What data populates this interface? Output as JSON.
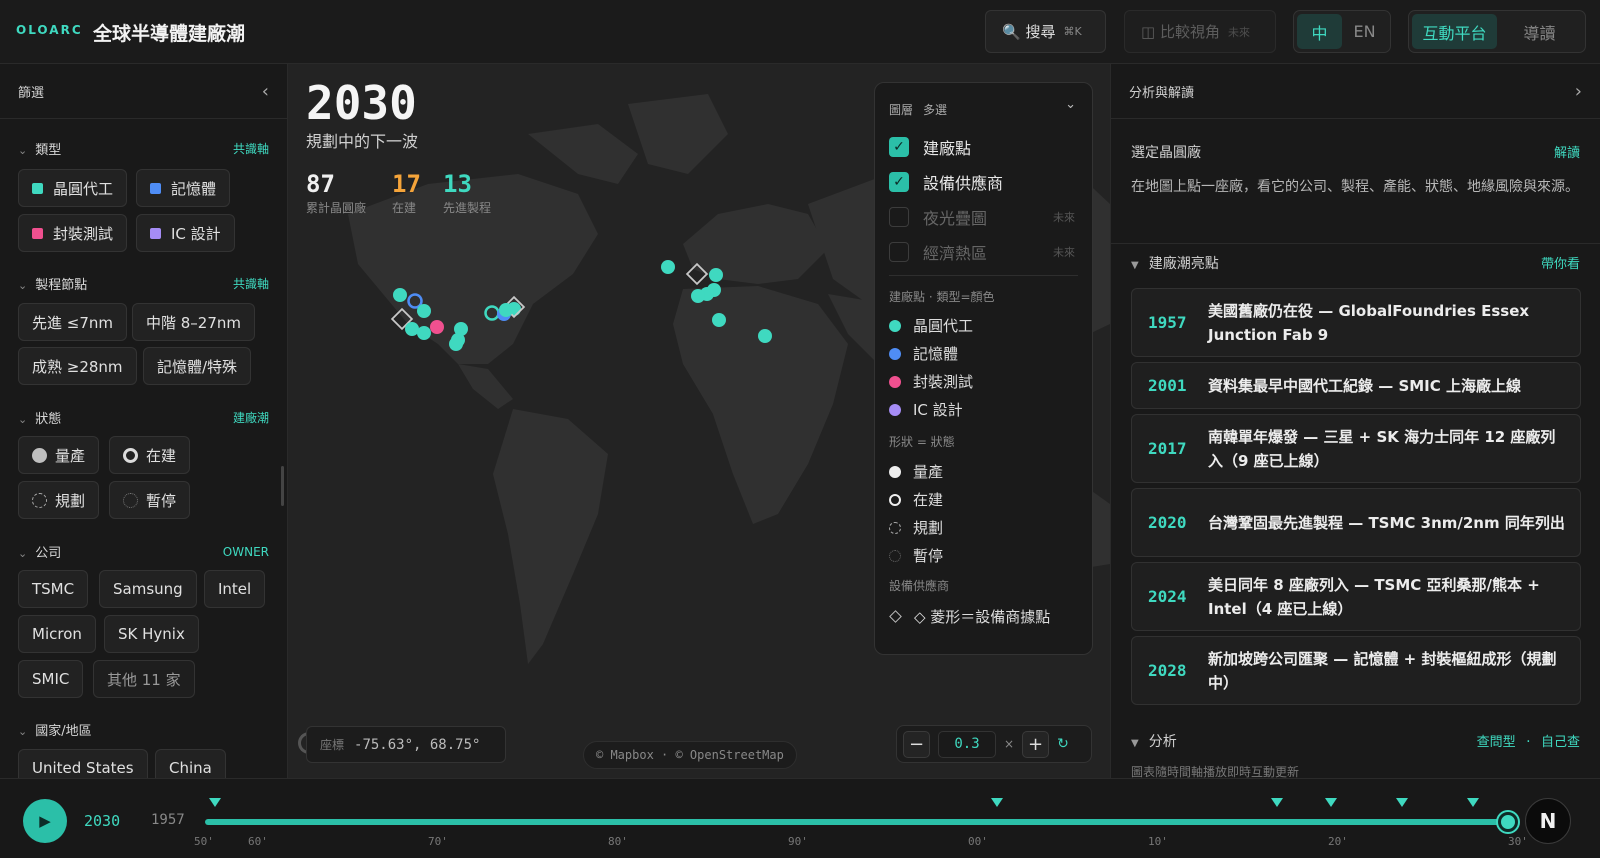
{
  "header": {
    "brand": "OLOARC",
    "title": "全球半導體建廠潮",
    "search_label": "🔍 搜尋",
    "search_kbd": "⌘K",
    "compare_label": "◫ 比較視角",
    "compare_soon": "未來",
    "lang_zh": "中",
    "lang_en": "EN",
    "mode_interactive": "互動平台",
    "mode_guide": "導讀"
  },
  "left": {
    "title": "篩選",
    "collapse_icon": "‹",
    "type": {
      "label": "類型",
      "tag": "共識軸",
      "items": [
        "晶圓代工",
        "記憶體",
        "封裝測試",
        "IC 設計"
      ]
    },
    "node": {
      "label": "製程節點",
      "tag": "共識軸",
      "items": [
        "先進 ≤7nm",
        "中階 8–27nm",
        "成熟 ≥28nm",
        "記憶體/特殊"
      ]
    },
    "status": {
      "label": "狀態",
      "tag": "建廠潮",
      "items": [
        "量產",
        "在建",
        "規劃",
        "暫停"
      ]
    },
    "company": {
      "label": "公司",
      "tag": "OWNER",
      "items": [
        "TSMC",
        "Samsung",
        "Intel",
        "Micron",
        "SK Hynix",
        "SMIC",
        "其他 11 家"
      ]
    },
    "region": {
      "label": "國家/地區",
      "items": [
        "United States",
        "China"
      ]
    }
  },
  "map": {
    "year": "2030",
    "subtitle": "規劃中的下一波",
    "stats": [
      {
        "value": "87",
        "label": "累計晶圓廠",
        "color": "#f0f0f0"
      },
      {
        "value": "17",
        "label": "在建",
        "color": "#f5a43a"
      },
      {
        "value": "13",
        "label": "先進製程",
        "color": "#3fd9c0"
      }
    ],
    "coord_label": "座標",
    "coord_value": "-75.63°, 68.75°",
    "attribution": "© Mapbox · © OpenStreetMap",
    "zoom_value": "0.3",
    "zoom_unit": "×"
  },
  "layers": {
    "title": "圖層",
    "mode": "多選",
    "toggles": [
      {
        "label": "建廠點",
        "on": true
      },
      {
        "label": "設備供應商",
        "on": true
      },
      {
        "label": "夜光疊圖",
        "on": false,
        "soon": "未來"
      },
      {
        "label": "經濟熱區",
        "on": false,
        "soon": "未來"
      }
    ],
    "type_caption": "建廠點 · 類型=顏色",
    "type_legend": [
      "晶圓代工",
      "記憶體",
      "封裝測試",
      "IC 設計"
    ],
    "shape_caption": "形狀 = 狀態",
    "shape_legend": [
      "量產",
      "在建",
      "規劃",
      "暫停"
    ],
    "supplier_caption": "設備供應商",
    "supplier_legend": "◇ 菱形＝設備商據點"
  },
  "right": {
    "title": "分析與解讀",
    "expand_icon": "›",
    "selected_label": "選定晶圓廠",
    "selected_tag": "解讀",
    "selected_desc": "在地圖上點一座廠，看它的公司、製程、產能、狀態、地緣風險與來源。",
    "highlights_label": "建廠潮亮點",
    "highlights_tag": "帶你看",
    "highlights": [
      {
        "year": "1957",
        "text": "美國舊廠仍在役 — GlobalFoundries Essex Junction Fab 9"
      },
      {
        "year": "2001",
        "text": "資料集最早中國代工紀錄 — SMIC 上海廠上線"
      },
      {
        "year": "2017",
        "text": "南韓單年爆發 — 三星 + SK 海力士同年 12 座廠列入（9 座已上線）"
      },
      {
        "year": "2020",
        "text": "台灣鞏固最先進製程 — TSMC 3nm/2nm 同年列出"
      },
      {
        "year": "2024",
        "text": "美日同年 8 座廠列入 — TSMC 亞利桑那/熊本 + Intel（4 座已上線）"
      },
      {
        "year": "2028",
        "text": "新加坡跨公司匯聚 — 記憶體 + 封裝樞紐成形（規劃中）"
      }
    ],
    "analysis_label": "分析",
    "analysis_tag_1": "查問型",
    "analysis_sep": "·",
    "analysis_tag_2": "自己查",
    "analysis_note": "圖表隨時間軸播放即時互動更新"
  },
  "timeline": {
    "play_icon": "▶",
    "current_year": "2030",
    "start_year": "1957",
    "ticks": [
      "50'",
      "60'",
      "70'",
      "80'",
      "90'",
      "00'",
      "10'",
      "20'",
      "30'"
    ],
    "avatar_letter": "N"
  },
  "colors": {
    "foundry": "#3fd9c0",
    "memory": "#4f8df5",
    "packaging": "#f0508f",
    "ic_design": "#a58cf5",
    "accent": "#3fd9c0",
    "in_construction": "#f5a43a"
  }
}
